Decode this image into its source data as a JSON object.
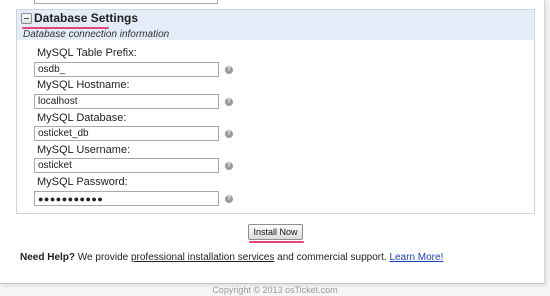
{
  "section": {
    "title": "Database Settings",
    "description": "Database connection information"
  },
  "fields": [
    {
      "label": "MySQL Table Prefix:",
      "value": "osdb_"
    },
    {
      "label": "MySQL Hostname:",
      "value": "localhost"
    },
    {
      "label": "MySQL Database:",
      "value": "osticket_db"
    },
    {
      "label": "MySQL Username:",
      "value": "osticket"
    },
    {
      "label": "MySQL Password:",
      "value": "●●●●●●●●●●●"
    }
  ],
  "help_icon_glyph": "?",
  "install_button_label": "Install Now",
  "help": {
    "prefix": "Need Help?",
    "text_before": " We provide ",
    "link_services": "professional installation services",
    "text_after": " and commercial support. ",
    "link_learn": "Learn More!"
  },
  "footer": "Copyright © 2013 osTicket.com",
  "colors": {
    "header_bg": "#e4ecf7",
    "highlight_underline": "#e0487a",
    "link_blue": "#1a44b8"
  }
}
